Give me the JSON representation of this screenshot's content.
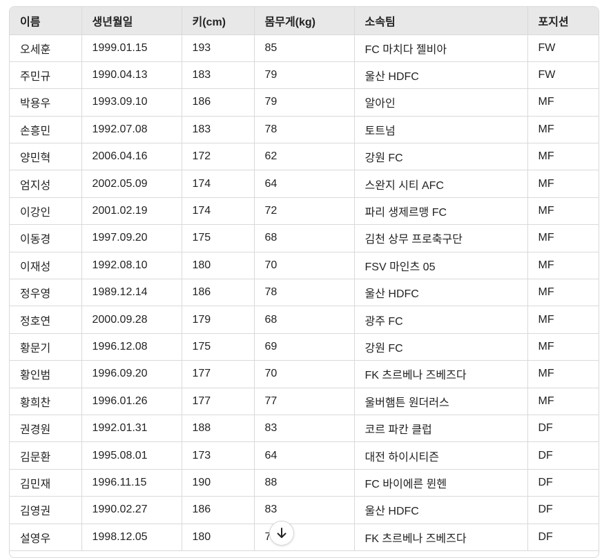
{
  "table": {
    "headers": [
      "이름",
      "생년월일",
      "키(cm)",
      "몸무게(kg)",
      "소속팀",
      "포지션"
    ],
    "rows": [
      [
        "오세훈",
        "1999.01.15",
        "193",
        "85",
        "FC 마치다 젤비아",
        "FW"
      ],
      [
        "주민규",
        "1990.04.13",
        "183",
        "79",
        "울산 HDFC",
        "FW"
      ],
      [
        "박용우",
        "1993.09.10",
        "186",
        "79",
        "알아인",
        "MF"
      ],
      [
        "손흥민",
        "1992.07.08",
        "183",
        "78",
        "토트넘",
        "MF"
      ],
      [
        "양민혁",
        "2006.04.16",
        "172",
        "62",
        "강원 FC",
        "MF"
      ],
      [
        "엄지성",
        "2002.05.09",
        "174",
        "64",
        "스완지 시티 AFC",
        "MF"
      ],
      [
        "이강인",
        "2001.02.19",
        "174",
        "72",
        "파리 생제르맹 FC",
        "MF"
      ],
      [
        "이동경",
        "1997.09.20",
        "175",
        "68",
        "김천 상무 프로축구단",
        "MF"
      ],
      [
        "이재성",
        "1992.08.10",
        "180",
        "70",
        "FSV 마인츠 05",
        "MF"
      ],
      [
        "정우영",
        "1989.12.14",
        "186",
        "78",
        "울산 HDFC",
        "MF"
      ],
      [
        "정호연",
        "2000.09.28",
        "179",
        "68",
        "광주 FC",
        "MF"
      ],
      [
        "황문기",
        "1996.12.08",
        "175",
        "69",
        "강원 FC",
        "MF"
      ],
      [
        "황인범",
        "1996.09.20",
        "177",
        "70",
        "FK 츠르베나 즈베즈다",
        "MF"
      ],
      [
        "황희찬",
        "1996.01.26",
        "177",
        "77",
        "울버햄튼 원더러스",
        "MF"
      ],
      [
        "권경원",
        "1992.01.31",
        "188",
        "83",
        "코르 파칸 클럽",
        "DF"
      ],
      [
        "김문환",
        "1995.08.01",
        "173",
        "64",
        "대전 하이시티즌",
        "DF"
      ],
      [
        "김민재",
        "1996.11.15",
        "190",
        "88",
        "FC 바이에른 뮌헨",
        "DF"
      ],
      [
        "김영권",
        "1990.02.27",
        "186",
        "83",
        "울산 HDFC",
        "DF"
      ],
      [
        "설영우",
        "1998.12.05",
        "180",
        "7",
        "FK 츠르베나 즈베즈다",
        "DF"
      ]
    ]
  },
  "scroll_button": {
    "icon": "arrow-down-icon"
  }
}
